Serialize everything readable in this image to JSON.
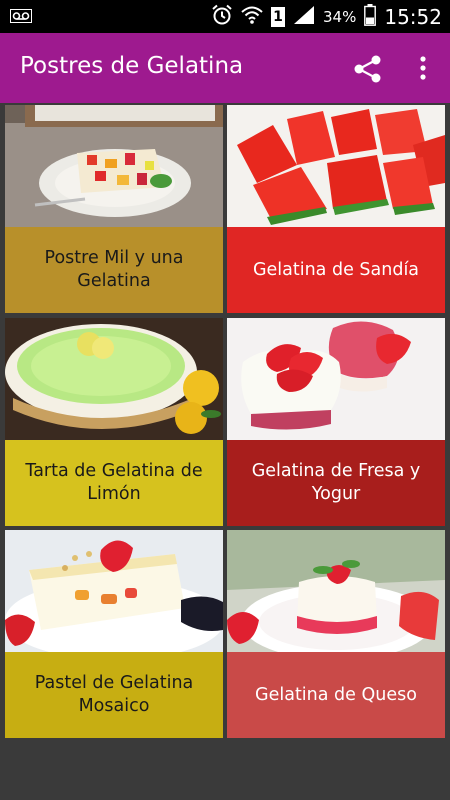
{
  "status_bar": {
    "time": "15:52",
    "battery": "34%",
    "sim": "1",
    "icons": [
      "voicemail-icon",
      "alarm-icon",
      "wifi-icon",
      "signal-icon",
      "battery-icon"
    ]
  },
  "app_bar": {
    "title": "Postres de Gelatina",
    "background": "#9e1a8f",
    "actions": [
      "share-icon",
      "more-vert-icon"
    ]
  },
  "recipes": [
    {
      "label": "Postre Mil y una Gelatina",
      "color": "#b8902a",
      "text_color": "#1a1a1a"
    },
    {
      "label": "Gelatina de Sandía",
      "color": "#e02624",
      "text_color": "#ffffff"
    },
    {
      "label": "Tarta de Gelatina de Limón",
      "color": "#d6c21e",
      "text_color": "#1a1a1a"
    },
    {
      "label": "Gelatina de Fresa y Yogur",
      "color": "#a81e1c",
      "text_color": "#ffffff"
    },
    {
      "label": "Pastel de Gelatina Mosaico",
      "color": "#c7ae12",
      "text_color": "#1a1a1a"
    },
    {
      "label": "Gelatina de Queso",
      "color": "#c94a48",
      "text_color": "#ffffff"
    }
  ]
}
